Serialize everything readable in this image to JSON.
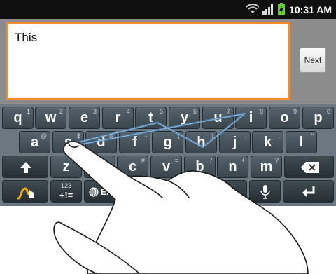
{
  "status_bar": {
    "time": "10:31 AM",
    "icons": [
      "wifi-icon",
      "signal-icon",
      "battery-charging-icon"
    ]
  },
  "compose": {
    "text": "This",
    "next_label": "Next"
  },
  "keyboard": {
    "row1": [
      {
        "main": "q",
        "sub": "1"
      },
      {
        "main": "w",
        "sub": "2"
      },
      {
        "main": "e",
        "sub": "3"
      },
      {
        "main": "r",
        "sub": "4"
      },
      {
        "main": "t",
        "sub": "5"
      },
      {
        "main": "y",
        "sub": "6"
      },
      {
        "main": "u",
        "sub": "7"
      },
      {
        "main": "i",
        "sub": "8"
      },
      {
        "main": "o",
        "sub": "9"
      },
      {
        "main": "p",
        "sub": "0"
      }
    ],
    "row2": [
      {
        "main": "a",
        "sub": "@"
      },
      {
        "main": "s",
        "sub": "$"
      },
      {
        "main": "d",
        "sub": "&"
      },
      {
        "main": "f",
        "sub": "-"
      },
      {
        "main": "g",
        "sub": "("
      },
      {
        "main": "h",
        "sub": ")"
      },
      {
        "main": "j",
        "sub": ":"
      },
      {
        "main": "k",
        "sub": ";"
      },
      {
        "main": "l",
        "sub": "\""
      }
    ],
    "row3": [
      {
        "main": "z",
        "sub": ""
      },
      {
        "main": "x",
        "sub": ""
      },
      {
        "main": "c",
        "sub": "#"
      },
      {
        "main": "v",
        "sub": "="
      },
      {
        "main": "b",
        "sub": "/"
      },
      {
        "main": "n",
        "sub": "+"
      },
      {
        "main": "m",
        "sub": "?"
      }
    ],
    "row4": {
      "sym_top": "123",
      "sym_bottom": "+!=",
      "lang": "EN",
      "punct": "'"
    },
    "icons": [
      "shift-icon",
      "backspace-icon",
      "swype-icon",
      "globe-icon",
      "microphone-icon",
      "enter-icon"
    ]
  },
  "colors": {
    "accent": "#f28c28",
    "keyboard_bg": "#6b7882",
    "swipe_trace": "#4a7fb0"
  }
}
